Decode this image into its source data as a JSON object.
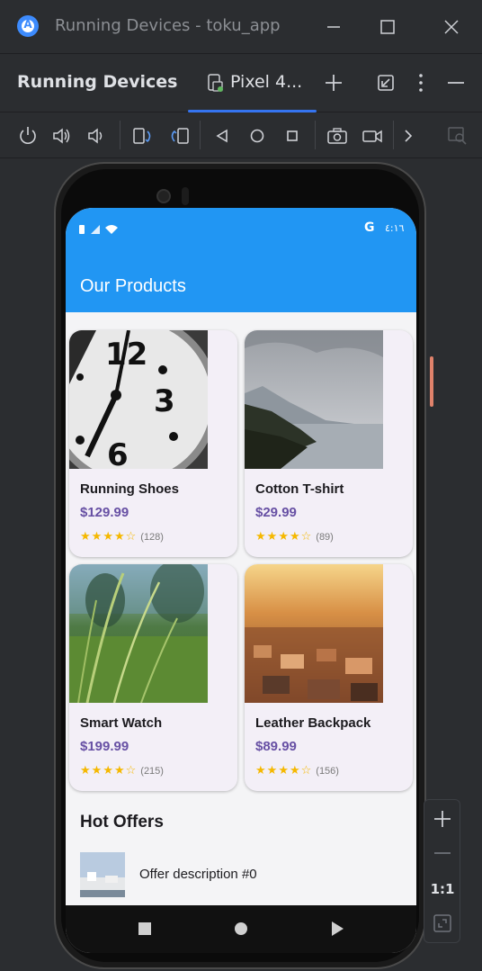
{
  "window": {
    "title": "Running Devices - toku_app",
    "logo_letter": "A"
  },
  "tool": {
    "title": "Running Devices",
    "tab_label": "Pixel 4..."
  },
  "device": {
    "status_time": "٤:١٦",
    "status_g": "G"
  },
  "app": {
    "title": "Our Products",
    "accent": "#2196f3",
    "price_color": "#6750a4",
    "products": [
      {
        "name": "Running Shoes",
        "price": "$129.99",
        "rating": 4,
        "count": "(128)"
      },
      {
        "name": "Cotton T-shirt",
        "price": "$29.99",
        "rating": 4,
        "count": "(89)"
      },
      {
        "name": "Smart Watch",
        "price": "$199.99",
        "rating": 4,
        "count": "(215)"
      },
      {
        "name": "Leather Backpack",
        "price": "$89.99",
        "rating": 4,
        "count": "(156)"
      }
    ],
    "section_title": "Hot Offers",
    "offers": [
      {
        "text": "Offer description #0"
      }
    ]
  },
  "zoom": {
    "reset_label": "1:1"
  }
}
